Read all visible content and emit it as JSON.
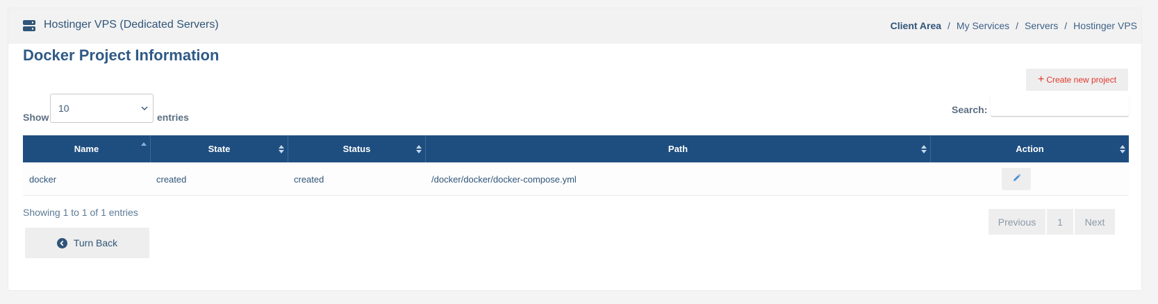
{
  "header": {
    "title": "Hostinger VPS (Dedicated Servers)",
    "icon": "server-icon",
    "breadcrumb": [
      "Client Area",
      "My Services",
      "Servers",
      "Hostinger VPS"
    ]
  },
  "page": {
    "title": "Docker Project Information",
    "create_button": "Create new project"
  },
  "controls": {
    "show_label": "Show",
    "entries_label": "entries",
    "page_size": "10",
    "search_label": "Search:",
    "search_value": ""
  },
  "table": {
    "columns": [
      "Name",
      "State",
      "Status",
      "Path",
      "Action"
    ],
    "rows": [
      {
        "name": "docker",
        "state": "created",
        "status": "created",
        "path": "/docker/docker/docker-compose.yml",
        "action_icon": "pencil-icon"
      }
    ]
  },
  "footer": {
    "info": "Showing 1 to 1 of 1 entries",
    "pagination": {
      "previous": "Previous",
      "current": "1",
      "next": "Next"
    },
    "turn_back": "Turn Back"
  },
  "colors": {
    "header_bg": "#1e4e80",
    "accent_red": "#e0352b",
    "title_blue": "#2f5a86"
  }
}
